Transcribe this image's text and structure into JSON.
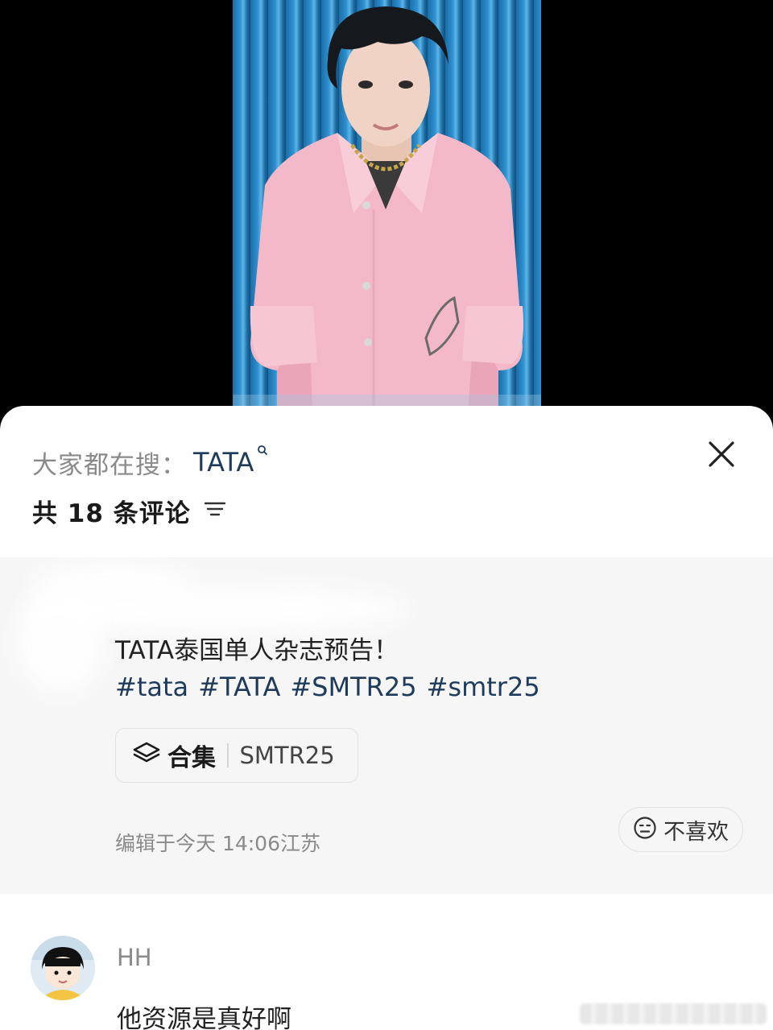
{
  "sheet": {
    "search_prefix": "大家都在搜：",
    "search_term": "TATA",
    "comment_count": "共 18 条评论"
  },
  "post": {
    "title": "TATA泰国单人杂志预告！",
    "tags": [
      "#tata",
      "#TATA",
      "#SMTR25",
      "#smtr25"
    ],
    "collection_label": "合集",
    "collection_name": "SMTR25",
    "edit_info": "编辑于今天 14:06江苏",
    "dislike_label": "不喜欢"
  },
  "comment": {
    "username": "HH",
    "text": "他资源是真好啊"
  },
  "colors": {
    "accent_link": "#1f3b5c",
    "muted_text": "#8a8a8a",
    "card_bg": "#f6f6f6",
    "shirt_pink": "#f4b9c9"
  }
}
